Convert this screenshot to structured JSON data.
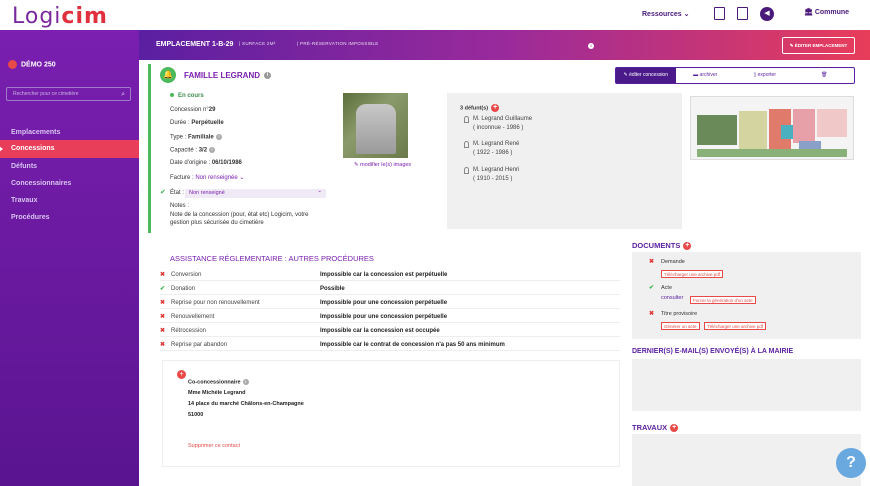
{
  "app": {
    "logo_part1": "Logi",
    "logo_part2": "cim",
    "ressources": "Ressources",
    "commune": "Commune"
  },
  "sidebar": {
    "site": "DÉMO 250",
    "search_placeholder": "Rechercher pour ce cimetière",
    "items": [
      {
        "label": "Emplacements"
      },
      {
        "label": "Concessions"
      },
      {
        "label": "Défunts"
      },
      {
        "label": "Concessionnaires"
      },
      {
        "label": "Travaux"
      },
      {
        "label": "Procédures"
      }
    ]
  },
  "header": {
    "title": "EMPLACEMENT 1-B-29",
    "surface": "SURFACE 2M²",
    "preres": "PRÉ-RÉSERVATION IMPOSSIBLE",
    "edit": "ÉDITER EMPLACEMENT"
  },
  "concession": {
    "famille": "FAMILLE LEGRAND",
    "status": "En cours",
    "numero_label": "Concession n°",
    "numero": "29",
    "duree_label": "Durée : ",
    "duree": "Perpétuelle",
    "type_label": "Type : ",
    "type": "Familiale",
    "capacite_label": "Capacité : ",
    "capacite": "3/2",
    "origine_label": "Date d'origine : ",
    "origine": "06/10/1986",
    "facture_label": "Facture : ",
    "facture": "Non renseignée",
    "etat_label": "État : ",
    "etat": "Non renseigné",
    "notes_label": "Notes :",
    "notes1": "Note de la concession (pour, état etc) Logicim, votre",
    "notes2": "gestion plus sécurisée du cimetière",
    "modif_images": "modifier le(s) images"
  },
  "actions": {
    "edit": "éditer concession",
    "archive": "archiver",
    "export": "exporter",
    "delete": "🗑"
  },
  "defunts": {
    "count": "3 défunt(s)",
    "list": [
      {
        "name": "M. Legrand Guillaume",
        "years": "( inconnue - 1986 )"
      },
      {
        "name": "M. Legrand René",
        "years": "( 1922 - 1986 )"
      },
      {
        "name": "M. Legrand Henri",
        "years": "( 1910 - 2015 )"
      }
    ]
  },
  "assistance": {
    "title": "ASSISTANCE RÉGLEMENTAIRE : AUTRES PROCÉDURES",
    "rows": [
      {
        "label": "Conversion",
        "value": "Impossible car la concession est perpétuelle",
        "ok": false
      },
      {
        "label": "Donation",
        "value": "Possible",
        "ok": true
      },
      {
        "label": "Reprise pour non renouvellement",
        "value": "Impossible pour une concession perpétuelle",
        "ok": false
      },
      {
        "label": "Renouvellement",
        "value": "Impossible pour une concession perpétuelle",
        "ok": false
      },
      {
        "label": "Rétrocession",
        "value": "Impossible car la concession est occupée",
        "ok": false
      },
      {
        "label": "Reprise par abandon",
        "value": "Impossible car le contrat de concession n'a pas 50 ans minimum",
        "ok": false
      }
    ]
  },
  "coconcessionnaire": {
    "title": "Co-concessionnaire",
    "name": "Mme  Michèle  Legrand",
    "address": "14 place du marché Châlons-en-Champagne",
    "cp": "51000",
    "delete": "Supprimer ce contact"
  },
  "documents": {
    "title": "DOCUMENTS",
    "demande": "Demande",
    "dl1": "Télécharger une archive pdf",
    "acte": "Acte",
    "consulter": "consulter",
    "force": "Forcer la génération d'un acte",
    "titre": "Titre provisoire",
    "gen": "Générer un acte",
    "dl2": "Télécharger une archive pdf"
  },
  "mails_title": "DERNIER(S) E-MAIL(S) ENVOYÉ(S) À LA MAIRIE",
  "travaux_title": "TRAVAUX",
  "help": "?"
}
